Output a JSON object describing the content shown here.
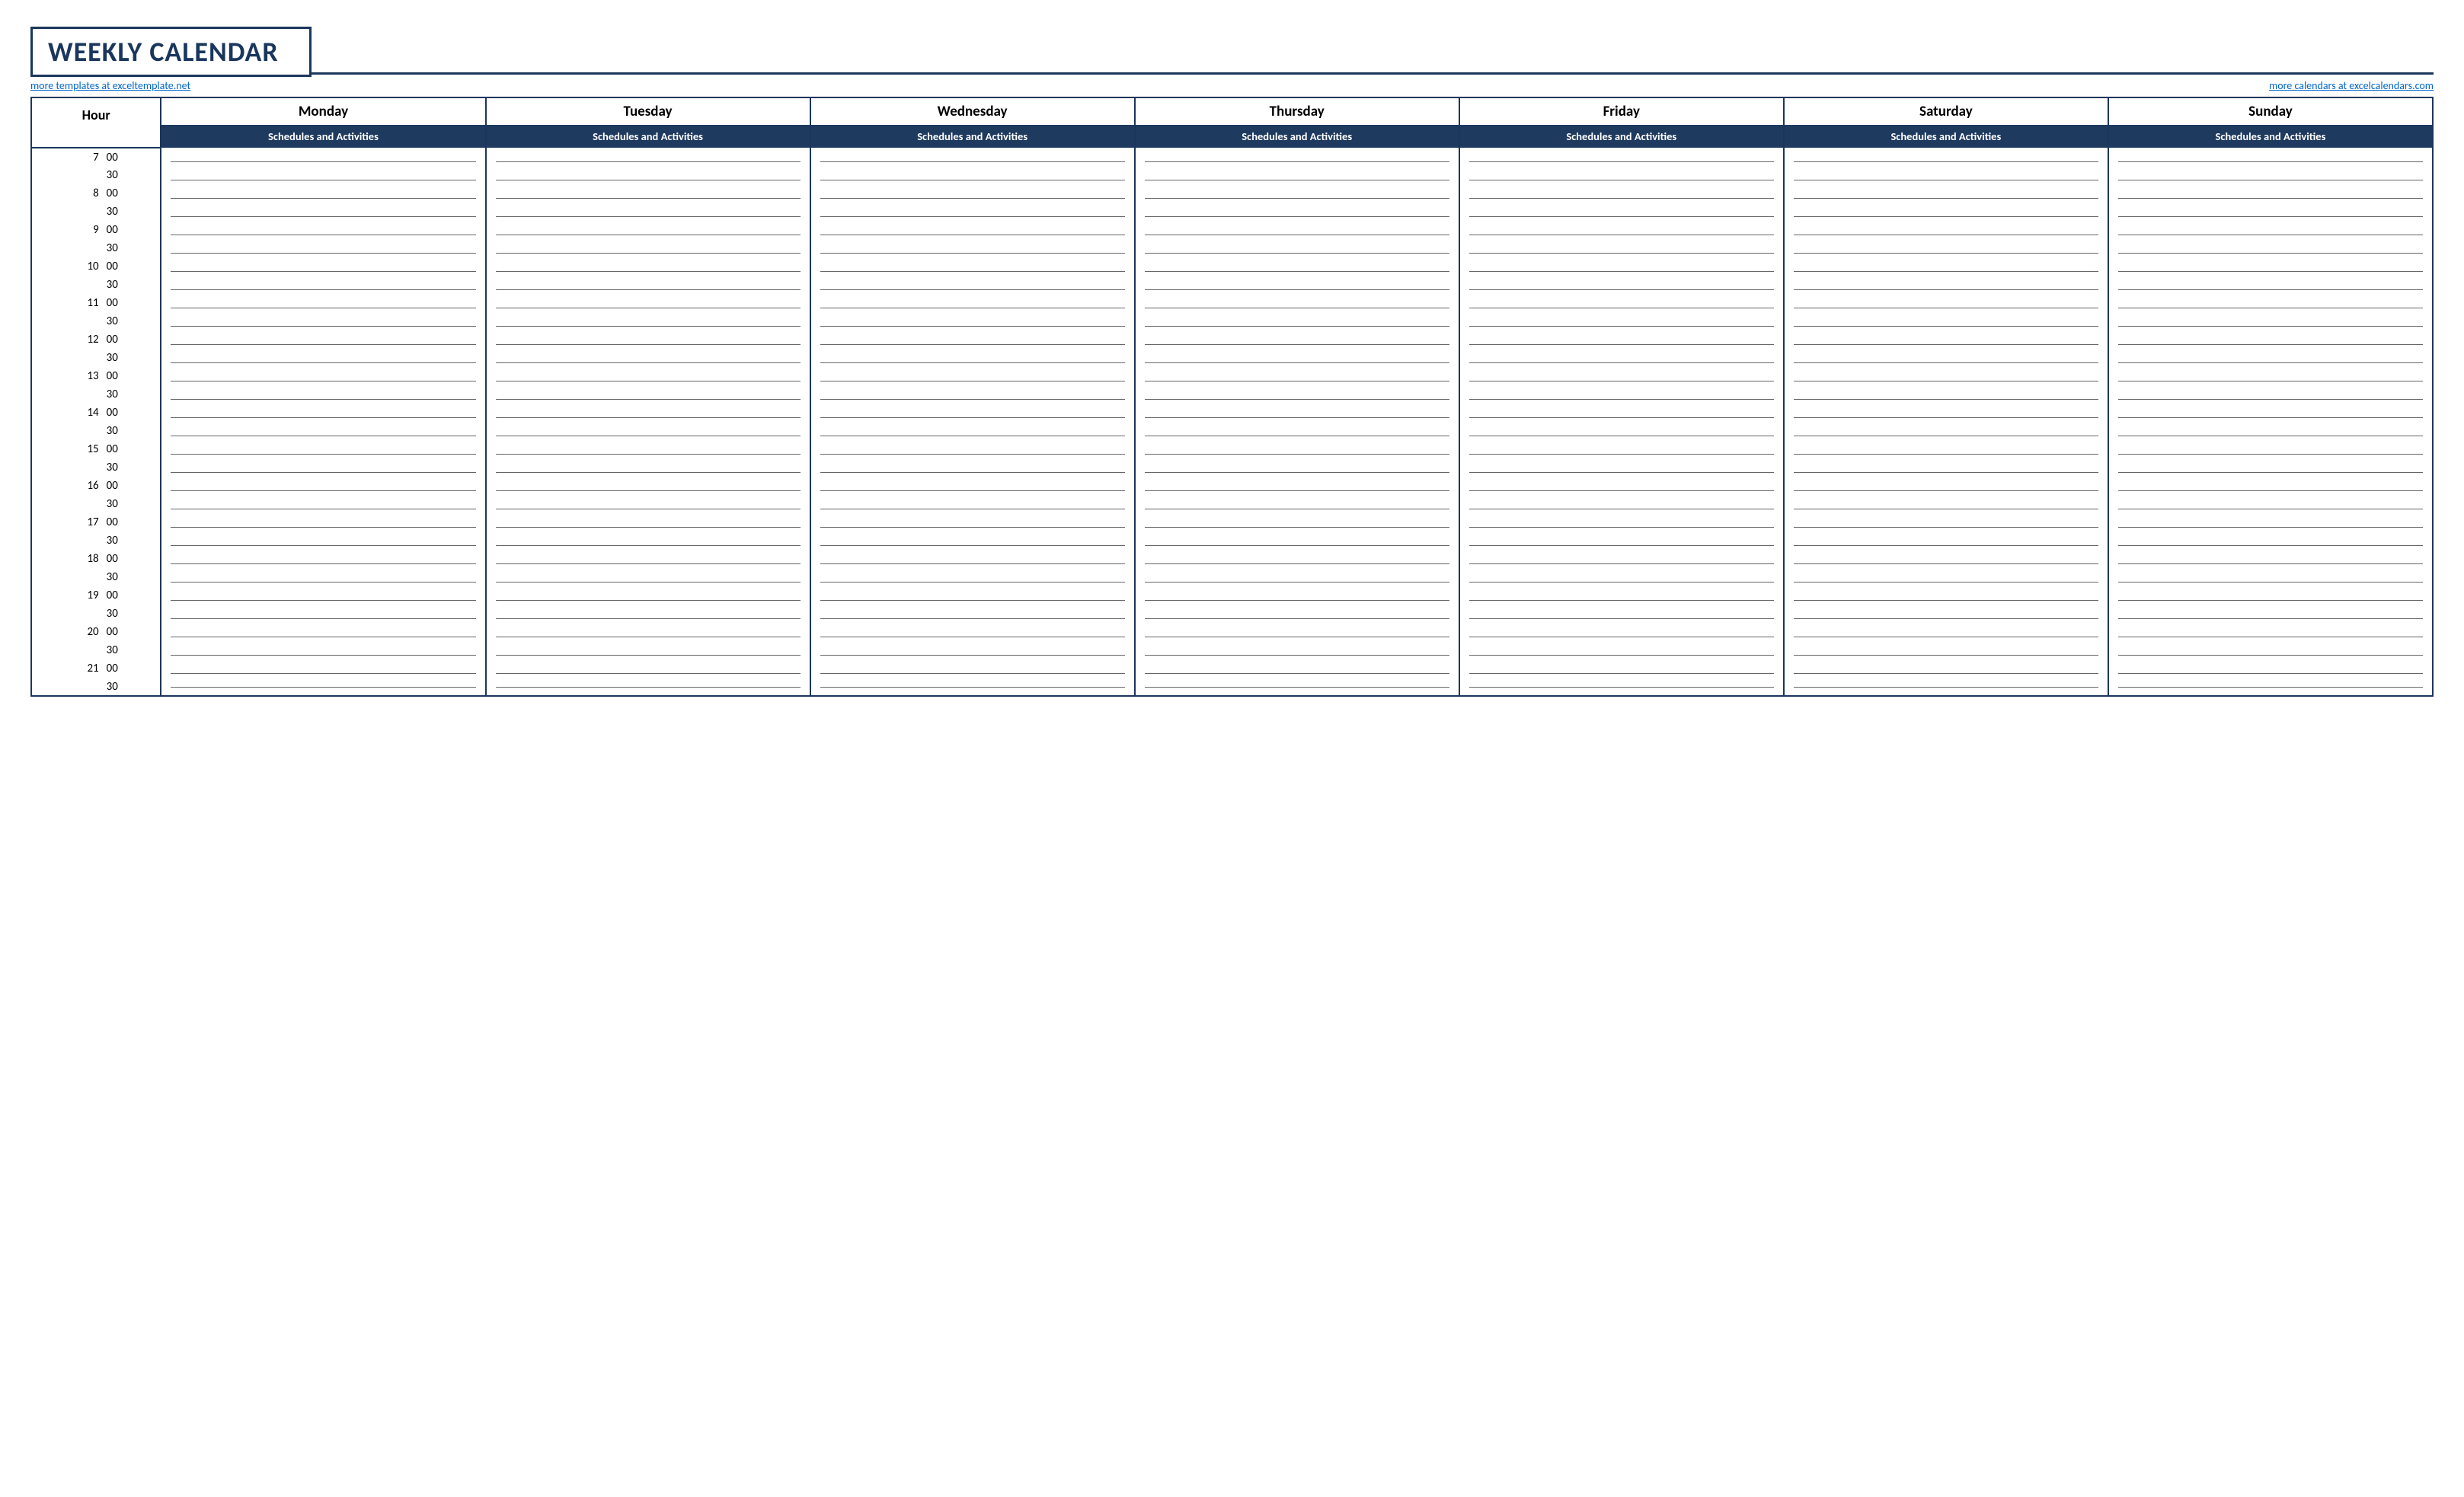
{
  "title": "WEEKLY CALENDAR",
  "links": {
    "left": "more templates at exceltemplate.net",
    "right": "more calendars at excelcalendars.com"
  },
  "headers": {
    "hour": "Hour",
    "days": [
      "Monday",
      "Tuesday",
      "Wednesday",
      "Thursday",
      "Friday",
      "Saturday",
      "Sunday"
    ],
    "sub": "Schedules and Activities"
  },
  "time_rows": [
    {
      "hour": "7",
      "min": "00"
    },
    {
      "hour": "",
      "min": "30"
    },
    {
      "hour": "8",
      "min": "00"
    },
    {
      "hour": "",
      "min": "30"
    },
    {
      "hour": "9",
      "min": "00"
    },
    {
      "hour": "",
      "min": "30"
    },
    {
      "hour": "10",
      "min": "00"
    },
    {
      "hour": "",
      "min": "30"
    },
    {
      "hour": "11",
      "min": "00"
    },
    {
      "hour": "",
      "min": "30"
    },
    {
      "hour": "12",
      "min": "00"
    },
    {
      "hour": "",
      "min": "30"
    },
    {
      "hour": "13",
      "min": "00"
    },
    {
      "hour": "",
      "min": "30"
    },
    {
      "hour": "14",
      "min": "00"
    },
    {
      "hour": "",
      "min": "30"
    },
    {
      "hour": "15",
      "min": "00"
    },
    {
      "hour": "",
      "min": "30"
    },
    {
      "hour": "16",
      "min": "00"
    },
    {
      "hour": "",
      "min": "30"
    },
    {
      "hour": "17",
      "min": "00"
    },
    {
      "hour": "",
      "min": "30"
    },
    {
      "hour": "18",
      "min": "00"
    },
    {
      "hour": "",
      "min": "30"
    },
    {
      "hour": "19",
      "min": "00"
    },
    {
      "hour": "",
      "min": "30"
    },
    {
      "hour": "20",
      "min": "00"
    },
    {
      "hour": "",
      "min": "30"
    },
    {
      "hour": "21",
      "min": "00"
    },
    {
      "hour": "",
      "min": "30"
    }
  ]
}
